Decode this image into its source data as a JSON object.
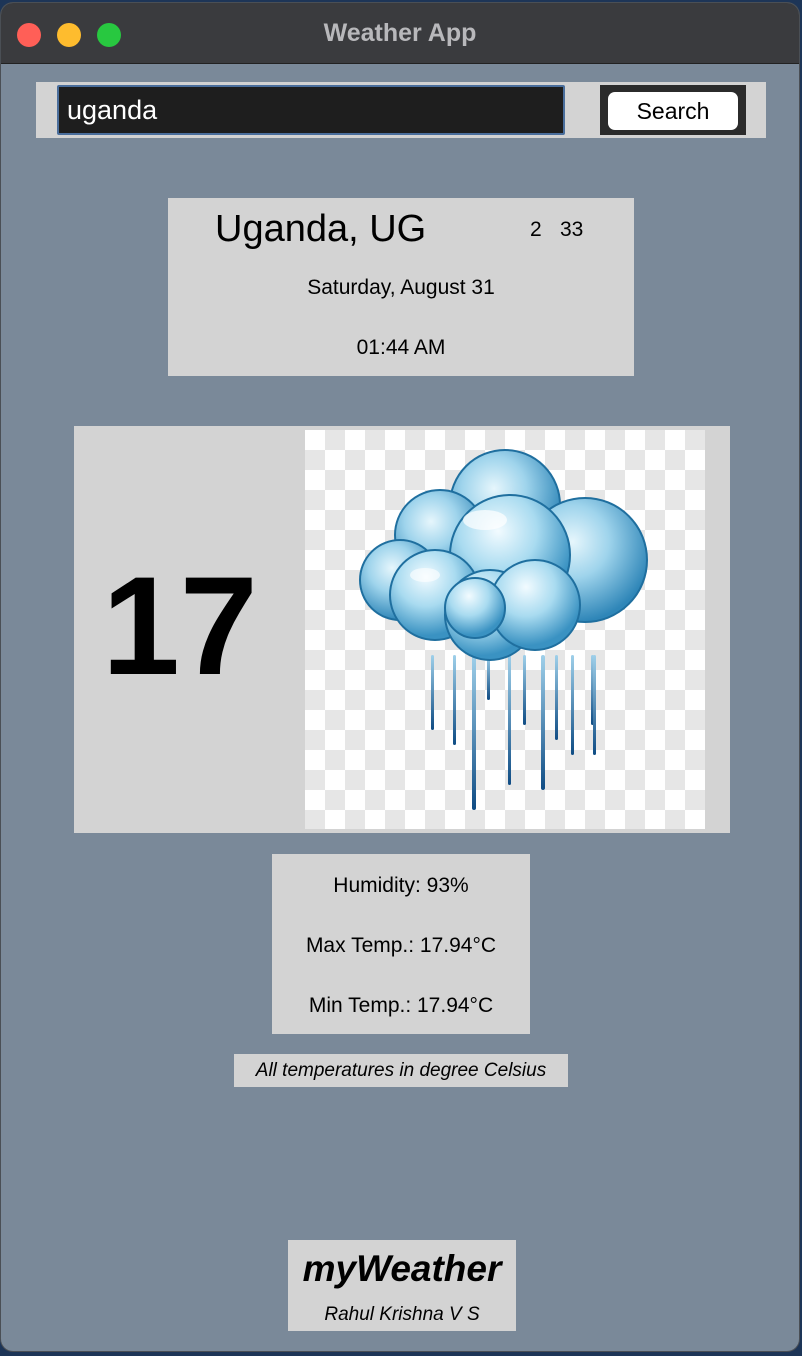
{
  "window": {
    "title": "Weather App"
  },
  "search": {
    "value": "uganda",
    "button_label": "Search"
  },
  "location": {
    "city": "Uganda, UG",
    "num_a": "2",
    "num_b": "33",
    "date": "Saturday, August 31",
    "time": "01:44 AM"
  },
  "current": {
    "temperature": "17",
    "icon": "rain-cloud-icon"
  },
  "stats": {
    "humidity": "Humidity: 93%",
    "max_temp": "Max Temp.: 17.94°C",
    "min_temp": "Min Temp.: 17.94°C"
  },
  "note": "All temperatures in degree Celsius",
  "footer": {
    "brand": "myWeather",
    "author": "Rahul Krishna V S"
  },
  "colors": {
    "window_bg": "#7a8999",
    "panel_bg": "#d3d3d3",
    "titlebar_bg": "#3a3b3e",
    "cloud_blue": "#4aa8d6"
  }
}
